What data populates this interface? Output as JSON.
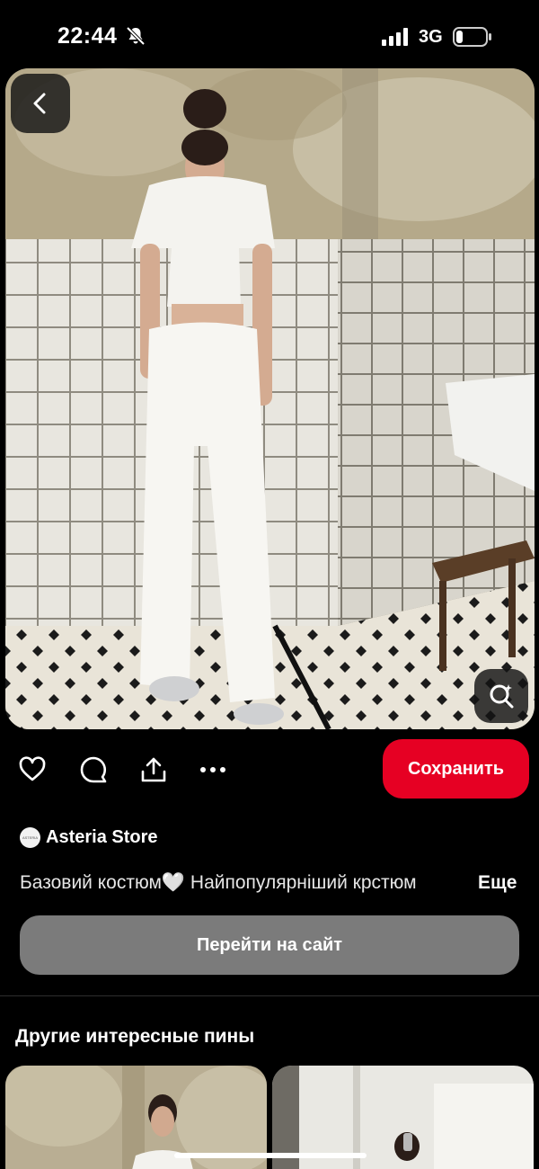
{
  "status_bar": {
    "time": "22:44",
    "network": "3G",
    "icons": [
      "bell-muted-icon",
      "signal-icon",
      "battery-icon"
    ]
  },
  "pin": {
    "image_icon": "fashion-photo",
    "back_icon": "chevron-left-icon",
    "lens_icon": "visual-search-icon"
  },
  "actions": {
    "icons": [
      "heart-icon",
      "comment-icon",
      "share-icon",
      "more-icon"
    ],
    "save_label": "Сохранить",
    "save_color": "#e60023"
  },
  "store": {
    "avatar_text": "ASTERIA",
    "name": "Asteria Store"
  },
  "description": {
    "text": "Базовий костюм🤍 Найпопулярніший крстюм",
    "more_label": "Еще"
  },
  "visit_label": "Перейти на сайт",
  "related": {
    "title": "Другие интересные пины"
  }
}
